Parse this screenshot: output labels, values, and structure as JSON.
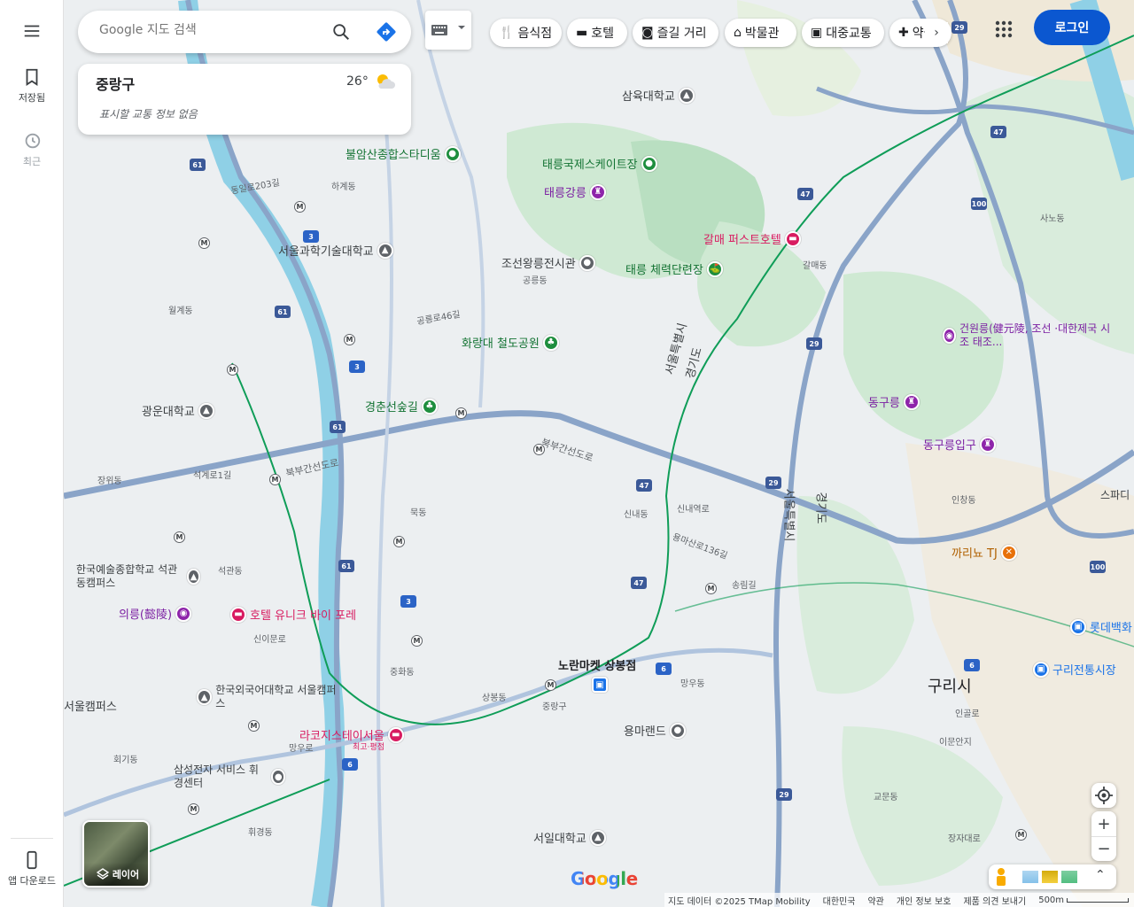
{
  "sidebar": {
    "saved": "저장됨",
    "recent": "최근",
    "app_download": "앱 다운로드"
  },
  "search": {
    "placeholder": "Google 지도 검색"
  },
  "weather": {
    "district": "중랑구",
    "temp": "26°",
    "traffic": "표시할 교통 정보 없음"
  },
  "chips": [
    "음식점",
    "호텔",
    "즐길 거리",
    "박물관",
    "대중교통",
    "약국"
  ],
  "login": "로그인",
  "layer": "레이어",
  "footer": {
    "data": "지도 데이터 ©2025 TMap Mobility",
    "country": "대한민국",
    "terms": "약관",
    "privacy": "개인 정보 보호",
    "feedback": "제품 의견 보내기",
    "scale": "500m"
  },
  "google_logo": "Google",
  "map": {
    "pois": [
      {
        "t": "불암산종합스타디움",
        "c": "#1e8e3e",
        "tc": "#137333"
      },
      {
        "t": "태릉국제스케이트장",
        "c": "#1e8e3e",
        "tc": "#137333"
      },
      {
        "t": "태릉강릉",
        "c": "#7b1fa2",
        "tc": "#7b1fa2"
      },
      {
        "t": "서울과학기술대학교",
        "c": "#5f6368",
        "tc": "#3c4043"
      },
      {
        "t": "조선왕릉전시관",
        "c": "#5f6368",
        "tc": "#3c4043"
      },
      {
        "t": "태릉 체력단련장",
        "c": "#1e8e3e",
        "tc": "#137333"
      },
      {
        "t": "갈매 퍼스트호텔",
        "c": "#d81b60",
        "tc": "#d81b60"
      },
      {
        "t": "화랑대 철도공원",
        "c": "#1e8e3e",
        "tc": "#137333"
      },
      {
        "t": "건원릉(健元陵, 조선 ·대한제국 시조 태조...",
        "c": "#7b1fa2",
        "tc": "#7b1fa2"
      },
      {
        "t": "광운대학교",
        "c": "#5f6368",
        "tc": "#3c4043"
      },
      {
        "t": "경춘선숲길",
        "c": "#1e8e3e",
        "tc": "#137333"
      },
      {
        "t": "동구릉",
        "c": "#7b1fa2",
        "tc": "#7b1fa2"
      },
      {
        "t": "동구릉입구",
        "c": "#7b1fa2",
        "tc": "#7b1fa2"
      },
      {
        "t": "한국예술종합학교 석관동캠퍼스",
        "c": "#5f6368",
        "tc": "#3c4043"
      },
      {
        "t": "의릉(懿陵)",
        "c": "#7b1fa2",
        "tc": "#7b1fa2"
      },
      {
        "t": "호텔 유니크 바이 포레",
        "c": "#d81b60",
        "tc": "#d81b60"
      },
      {
        "t": "까리뇨 TJ",
        "c": "#e8710a",
        "tc": "#b06000"
      },
      {
        "t": "노란마켓 상봉점",
        "c": "#1a73e8",
        "tc": "#202124"
      },
      {
        "t": "롯데백화",
        "c": "#1a73e8",
        "tc": "#1a73e8"
      },
      {
        "t": "구리전통시장",
        "c": "#1a73e8",
        "tc": "#1a73e8"
      },
      {
        "t": "한국외국어대학교 서울캠퍼스",
        "c": "#5f6368",
        "tc": "#3c4043"
      },
      {
        "t": "라코지스테이서울",
        "c": "#d81b60",
        "tc": "#d81b60"
      },
      {
        "t": "용마랜드",
        "c": "#5f6368",
        "tc": "#3c4043"
      },
      {
        "t": "삼성전자 서비스 휘경센터",
        "c": "#5f6368",
        "tc": "#3c4043"
      },
      {
        "t": "서일대학교",
        "c": "#5f6368",
        "tc": "#3c4043"
      },
      {
        "t": "삼육대학교",
        "c": "#5f6368",
        "tc": "#3c4043"
      }
    ],
    "labels": [
      "하계동",
      "공릉동",
      "월계동",
      "갈매동",
      "사노동",
      "장위동",
      "석관동",
      "묵동",
      "신내동",
      "신이문로",
      "중화동",
      "상봉동",
      "중랑구",
      "망우동",
      "휘경동",
      "회기동",
      "인창동",
      "교문동",
      "인창동",
      "구리시",
      "서울캠퍼스",
      "북부간선도로",
      "신내역로",
      "용마산로136길",
      "송림길",
      "경기도",
      "서울특별시",
      "동일로203길",
      "공릉로46길",
      "석계로1길",
      "망우로",
      "최고·평점",
      "이문안지",
      "인골로",
      "장자대로",
      "스파디"
    ]
  }
}
